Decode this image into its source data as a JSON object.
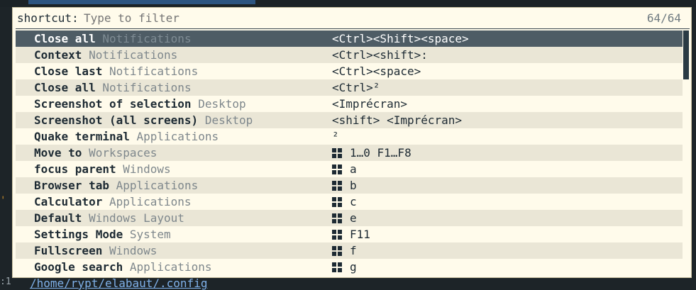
{
  "background": {
    "path_text": "/home/rypt/elabaut/.config",
    "left_fragment": ":1",
    "side_fragment": "' s"
  },
  "input": {
    "prompt": "shortcut:",
    "placeholder": "Type to filter",
    "count": "64/64"
  },
  "rows": [
    {
      "name": "Close all",
      "category": "Notifications",
      "keys": "<Ctrl><Shift><space>",
      "win_icon": false
    },
    {
      "name": "Context",
      "category": "Notifications",
      "keys": "<Ctrl><shift>:",
      "win_icon": false
    },
    {
      "name": "Close last",
      "category": "Notifications",
      "keys": "<Ctrl><space>",
      "win_icon": false
    },
    {
      "name": "Close all",
      "category": "Notifications",
      "keys": "<Ctrl>²",
      "win_icon": false
    },
    {
      "name": "Screenshot of selection",
      "category": "Desktop",
      "keys": "<Imprécran>",
      "win_icon": false
    },
    {
      "name": "Screenshot (all screens)",
      "category": "Desktop",
      "keys": "<shift> <Imprécran>",
      "win_icon": false
    },
    {
      "name": "Quake terminal",
      "category": "Applications",
      "keys": "²",
      "win_icon": false
    },
    {
      "name": "Move to",
      "category": "Workspaces",
      "keys": "1…0 F1…F8",
      "win_icon": true
    },
    {
      "name": "focus  parent",
      "category": "Windows",
      "keys": "a",
      "win_icon": true
    },
    {
      "name": "Browser tab",
      "category": "Applications",
      "keys": "b",
      "win_icon": true
    },
    {
      "name": "Calculator",
      "category": "Applications",
      "keys": "c",
      "win_icon": true
    },
    {
      "name": "Default ",
      "category": "Windows Layout",
      "keys": "e",
      "win_icon": true
    },
    {
      "name": "Settings Mode",
      "category": "System",
      "keys": "F11",
      "win_icon": true
    },
    {
      "name": "Fullscreen",
      "category": "Windows",
      "keys": "f",
      "win_icon": true
    },
    {
      "name": "Google search",
      "category": "Applications",
      "keys": "g",
      "win_icon": true
    }
  ],
  "selected_index": 0,
  "scroll": {
    "fraction_visible": 0.2
  }
}
